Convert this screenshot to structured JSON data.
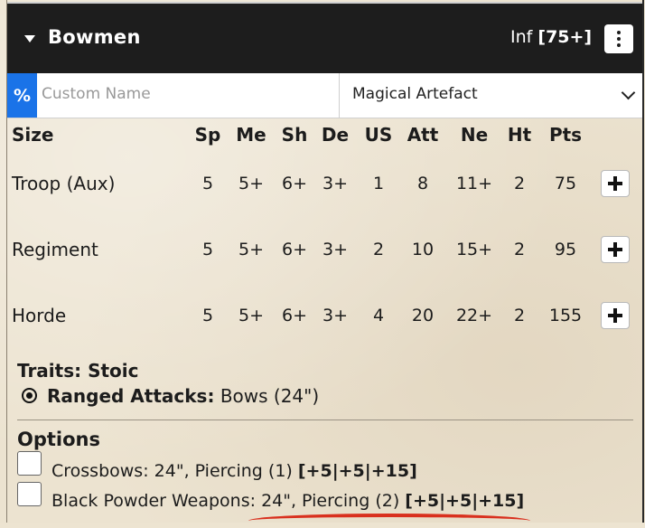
{
  "unit": {
    "name": "Bowmen",
    "type": "Inf",
    "cost": "[75+]"
  },
  "name_field": {
    "icon_text": "%",
    "placeholder": "Custom Name",
    "artefact_selected": "Magical Artefact"
  },
  "stats": {
    "headers": [
      "Size",
      "Sp",
      "Me",
      "Sh",
      "De",
      "US",
      "Att",
      "Ne",
      "Ht",
      "Pts"
    ],
    "rows": [
      {
        "size": "Troop (Aux)",
        "values": [
          "5",
          "5+",
          "6+",
          "3+",
          "1",
          "8",
          "11+",
          "2",
          "75"
        ]
      },
      {
        "size": "Regiment",
        "values": [
          "5",
          "5+",
          "6+",
          "3+",
          "2",
          "10",
          "15+",
          "2",
          "95"
        ]
      },
      {
        "size": "Horde",
        "values": [
          "5",
          "5+",
          "6+",
          "3+",
          "4",
          "20",
          "22+",
          "2",
          "155"
        ]
      }
    ]
  },
  "traits": {
    "text": "Traits: Stoic",
    "ranged_label": "Ranged Attacks:",
    "ranged_value": "Bows (24\")"
  },
  "options": {
    "title": "Options",
    "items": [
      {
        "text": "Crossbows: 24\", Piercing (1)",
        "price": "[+5|+5|+15]"
      },
      {
        "text": "Black Powder Weapons: 24\", Piercing (2)",
        "price": "[+5|+5|+15]"
      }
    ]
  },
  "colors": {
    "header_bg": "#1d1d1d",
    "accent_blue": "#1a73e8",
    "parchment": "#ece3d0",
    "scribble_red": "#d9301e"
  },
  "icons": [
    "chevron-down-icon",
    "kebab-menu-icon",
    "plus-icon",
    "target-icon",
    "percent-icon"
  ]
}
